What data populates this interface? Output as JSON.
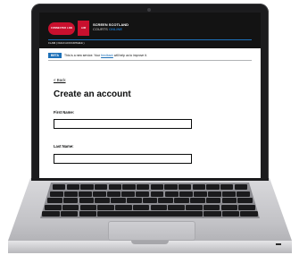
{
  "logo": {
    "mark_text": "CONNECTED LAW",
    "block_text": "LAW",
    "name": "SCREEN",
    "name_suffix": "SCOTLAND",
    "sub_line1": "COURTS",
    "sub_line2": "ONLINE"
  },
  "header": {
    "service_name": "CLAIM ( CHILD ACCOUNTABLE )"
  },
  "beta": {
    "tag": "BETA",
    "text_before": "This is a new service. Your",
    "link": "feedback",
    "text_after": "will help us to improve it."
  },
  "nav": {
    "back": "< Back"
  },
  "page": {
    "heading": "Create an account"
  },
  "form": {
    "first_name_label": "First Name:",
    "first_name_value": "",
    "last_name_label": "Last Name:",
    "last_name_value": ""
  },
  "colors": {
    "header_bg": "#131313",
    "brand_red": "#c8102e",
    "link_blue": "#1d70b8",
    "text": "#0b0c0c"
  }
}
